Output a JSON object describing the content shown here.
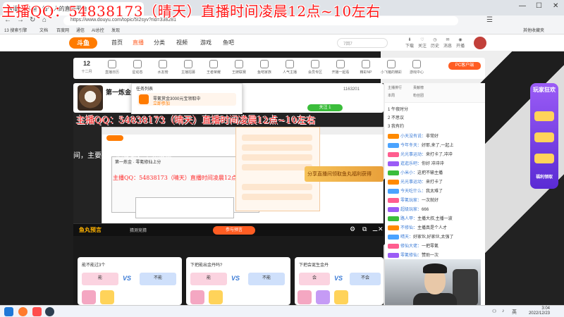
{
  "banner": {
    "text": "主播QQ：54838173（晴天）直播时间凌晨12点~10左右"
  },
  "browser": {
    "tab_title": "直播间-斗鱼 - 每个人的直播平台",
    "url": "https://www.douyu.com/topic/5I2syv?rid=338281",
    "bookmarks": [
      "13 搜索引擎",
      "文档",
      "百度网",
      "通信",
      "AI总控",
      "发现"
    ],
    "right_bookmark": "其他收藏夹"
  },
  "douyu_nav": {
    "logo": "斗鱼",
    "items": [
      "首页",
      "直播",
      "分类",
      "视频",
      "游戏",
      "鱼吧"
    ],
    "active": "直播",
    "search_placeholder": "7回7",
    "icons": [
      "下载",
      "关注",
      "历史",
      "消息",
      "开播",
      "福利"
    ]
  },
  "categories": {
    "day": "12",
    "month": "十二月",
    "items": [
      "直播日历",
      "星动态",
      "水友榜",
      "主播招募",
      "王者荣耀",
      "王牌联赛",
      "鱼吧家族",
      "人气主播",
      "会员专区",
      "开播一起看",
      "精彩NP",
      "小飞猪的精彩",
      "游戏中心"
    ],
    "pc_button": "PC客户端"
  },
  "streamer": {
    "name": "第一炼金 · 零氪修仙上分",
    "followers": "1163201",
    "follow_btn": "关注 1"
  },
  "popup": {
    "title": "任务列表",
    "item": "零氪赏金3000元宝领取中",
    "sub": "立即参加"
  },
  "overlay_small": "主播QQ：54838173（晴天）直播时间凌晨12点~10左右",
  "overlay_tiny": "主播QQ：54838173（晴天）直播时间凌晨12点~10左右",
  "left_text": "间，主要是一把零氪，不充值就",
  "gold_banner": "分享直播间领取鱼丸福利获得",
  "fishball": {
    "title": "鱼丸预言",
    "sub": "猜测竞猜",
    "btn": "参与预言",
    "icons": [
      "⚙",
      "⧉",
      "⚊",
      "✕"
    ]
  },
  "bets": [
    {
      "q": "能不能过3个",
      "a": "能",
      "b": "不能"
    },
    {
      "q": "下把能出金丹吗?",
      "a": "能",
      "b": "不能"
    },
    {
      "q": "下把会诞生金丹",
      "a": "会",
      "b": "不会"
    }
  ],
  "chat": {
    "tabs": [
      "主播排行",
      "贡献榜",
      "本周",
      "粉丝团"
    ],
    "ranks": [
      "1 午夜时分",
      "2 不思议",
      "3 我有约"
    ],
    "lines": [
      {
        "user": "小天没有说",
        "msg": "非常好"
      },
      {
        "user": "今年冬天",
        "msg": "好耶,来了,一起上"
      },
      {
        "user": "光光事运动",
        "msg": "来打卡了,冲冲"
      },
      {
        "user": "逛逛乐吧",
        "msg": "你好 冲冲冲"
      },
      {
        "user": "小米小",
        "msg": "这把不输主播"
      },
      {
        "user": "光光事运动",
        "msg": "来打卡了"
      },
      {
        "user": "今天吃什么",
        "msg": "我太难了"
      },
      {
        "user": "零氪玩家",
        "msg": "一次就好"
      },
      {
        "user": "超级玩家",
        "msg": "666"
      },
      {
        "user": "路人甲",
        "msg": "主播大叔,主播一波"
      },
      {
        "user": "不修仙",
        "msg": "主播真是个人才"
      },
      {
        "user": "晴天",
        "msg": "好家伙,好家伙,太强了"
      },
      {
        "user": "修仙大佬",
        "msg": "一把零氪"
      },
      {
        "user": "零氪修仙",
        "msg": "赞助一次"
      }
    ]
  },
  "promo": {
    "title": "玩家狂欢",
    "sub": "福利领取"
  },
  "taskbar": {
    "time": "3:04",
    "date": "2022/12/23"
  },
  "colors": {
    "accent": "#ff5d23",
    "banner_red": "#ff1a1a",
    "douyu_orange": "#ff7b00"
  }
}
